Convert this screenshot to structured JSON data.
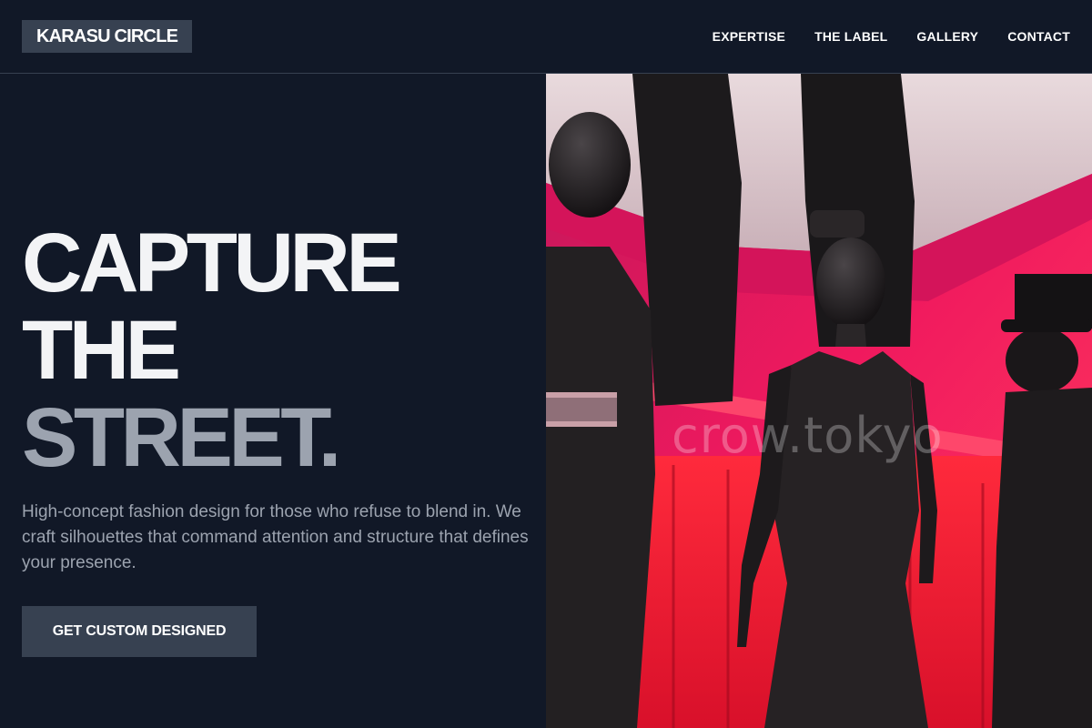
{
  "brand": {
    "name": "KARASU CIRCLE"
  },
  "nav": {
    "items": [
      {
        "label": "EXPERTISE"
      },
      {
        "label": "THE LABEL"
      },
      {
        "label": "GALLERY"
      },
      {
        "label": "CONTACT"
      }
    ]
  },
  "hero": {
    "headline_line1": "CAPTURE",
    "headline_line2": "THE",
    "headline_line3": "STREET.",
    "description": "High-concept fashion design for those who refuse to blend in. We craft silhouettes that command attention and structure that defines your presence.",
    "cta_label": "GET CUSTOM DESIGNED"
  },
  "image": {
    "subject": "black-clad mannequins in a red-pink lit display",
    "watermark": "crow.tokyo"
  },
  "colors": {
    "background": "#111827",
    "logo_bg": "#374151",
    "button_bg": "#374151",
    "text_primary": "#f3f4f6",
    "text_muted": "#9ca3af",
    "accent_pink": "#e11d5c"
  }
}
